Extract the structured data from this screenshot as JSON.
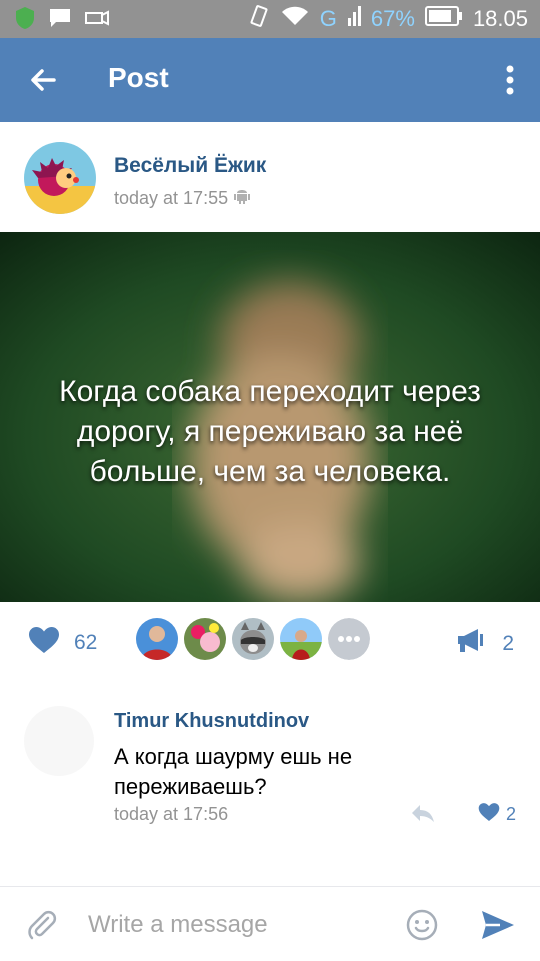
{
  "status_bar": {
    "battery_percent": "67%",
    "time": "18.05",
    "network": "G",
    "icons": [
      "shield-icon",
      "message-icon",
      "bell-icon",
      "vibrate-icon",
      "wifi-icon",
      "signal-icon",
      "battery-icon"
    ]
  },
  "app_bar": {
    "title": "Post",
    "back_icon": "arrow-left-icon",
    "menu_icon": "more-vertical-icon"
  },
  "post": {
    "author_name": "Весёлый Ёжик",
    "timestamp": "today at 17:55",
    "platform_icon": "android-icon",
    "image_text_line1": "Когда собака переходит через",
    "image_text_line2": "дорогу, я переживаю за неё",
    "image_text_line3": "больше, чем за человека.",
    "likes_count": "62",
    "shares_count": "2",
    "likers_more_icon": "more-horizontal-icon"
  },
  "comment": {
    "author_name": "Timur Khusnutdinov",
    "text": "А когда шаурму ешь не переживаешь?",
    "timestamp": "today at 17:56",
    "likes_count": "2"
  },
  "composer": {
    "placeholder": "Write a message",
    "attach_icon": "paperclip-icon",
    "emoji_icon": "smile-icon",
    "send_icon": "send-icon"
  },
  "colors": {
    "accent": "#5181b8",
    "link": "#2a5885",
    "muted": "#939393",
    "status_bar": "#929292"
  }
}
